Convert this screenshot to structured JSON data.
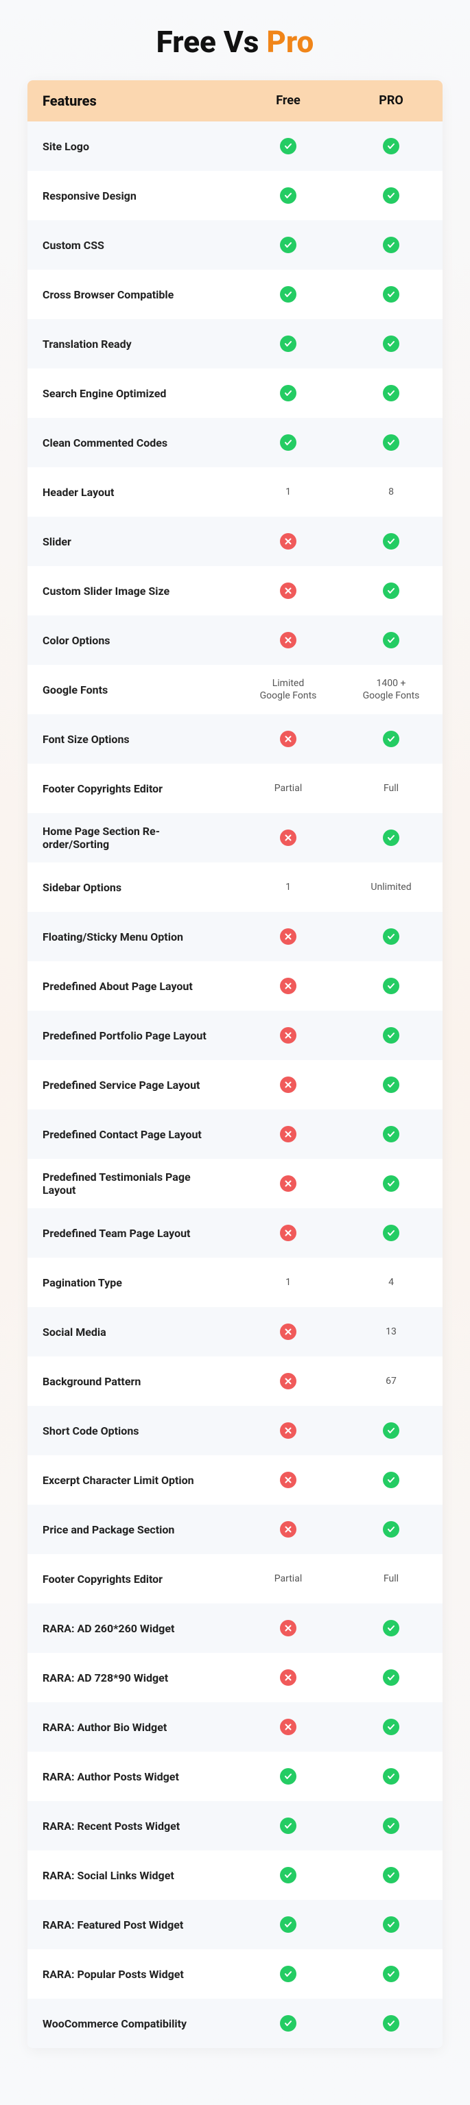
{
  "title": {
    "part1": "Free Vs ",
    "part2": "Pro"
  },
  "header": {
    "features": "Features",
    "free": "Free",
    "pro": "PRO"
  },
  "rows": [
    {
      "feature": "Site Logo",
      "free": {
        "type": "yes"
      },
      "pro": {
        "type": "yes"
      }
    },
    {
      "feature": "Responsive Design",
      "free": {
        "type": "yes"
      },
      "pro": {
        "type": "yes"
      }
    },
    {
      "feature": "Custom CSS",
      "free": {
        "type": "yes"
      },
      "pro": {
        "type": "yes"
      }
    },
    {
      "feature": "Cross Browser Compatible",
      "free": {
        "type": "yes"
      },
      "pro": {
        "type": "yes"
      }
    },
    {
      "feature": "Translation Ready",
      "free": {
        "type": "yes"
      },
      "pro": {
        "type": "yes"
      }
    },
    {
      "feature": "Search Engine Optimized",
      "free": {
        "type": "yes"
      },
      "pro": {
        "type": "yes"
      }
    },
    {
      "feature": "Clean Commented Codes",
      "free": {
        "type": "yes"
      },
      "pro": {
        "type": "yes"
      }
    },
    {
      "feature": "Header Layout",
      "free": {
        "type": "text",
        "value": "1"
      },
      "pro": {
        "type": "text",
        "value": "8"
      }
    },
    {
      "feature": "Slider",
      "free": {
        "type": "no"
      },
      "pro": {
        "type": "yes"
      }
    },
    {
      "feature": "Custom Slider Image Size",
      "free": {
        "type": "no"
      },
      "pro": {
        "type": "yes"
      }
    },
    {
      "feature": "Color Options",
      "free": {
        "type": "no"
      },
      "pro": {
        "type": "yes"
      }
    },
    {
      "feature": "Google Fonts",
      "free": {
        "type": "text",
        "value": "Limited\nGoogle Fonts"
      },
      "pro": {
        "type": "text",
        "value": "1400 +\nGoogle Fonts"
      }
    },
    {
      "feature": "Font Size Options",
      "free": {
        "type": "no"
      },
      "pro": {
        "type": "yes"
      }
    },
    {
      "feature": "Footer Copyrights Editor",
      "free": {
        "type": "text",
        "value": "Partial"
      },
      "pro": {
        "type": "text",
        "value": "Full"
      }
    },
    {
      "feature": "Home Page Section Re-order/Sorting",
      "free": {
        "type": "no"
      },
      "pro": {
        "type": "yes"
      }
    },
    {
      "feature": "Sidebar Options",
      "free": {
        "type": "text",
        "value": "1"
      },
      "pro": {
        "type": "text",
        "value": "Unlimited"
      }
    },
    {
      "feature": "Floating/Sticky Menu Option",
      "free": {
        "type": "no"
      },
      "pro": {
        "type": "yes"
      }
    },
    {
      "feature": "Predefined About Page Layout",
      "free": {
        "type": "no"
      },
      "pro": {
        "type": "yes"
      }
    },
    {
      "feature": "Predefined Portfolio Page Layout",
      "free": {
        "type": "no"
      },
      "pro": {
        "type": "yes"
      }
    },
    {
      "feature": "Predefined Service Page Layout",
      "free": {
        "type": "no"
      },
      "pro": {
        "type": "yes"
      }
    },
    {
      "feature": "Predefined Contact Page Layout",
      "free": {
        "type": "no"
      },
      "pro": {
        "type": "yes"
      }
    },
    {
      "feature": "Predefined Testimonials Page Layout",
      "free": {
        "type": "no"
      },
      "pro": {
        "type": "yes"
      }
    },
    {
      "feature": "Predefined Team Page Layout",
      "free": {
        "type": "no"
      },
      "pro": {
        "type": "yes"
      }
    },
    {
      "feature": "Pagination Type",
      "free": {
        "type": "text",
        "value": "1"
      },
      "pro": {
        "type": "text",
        "value": "4"
      }
    },
    {
      "feature": "Social Media",
      "free": {
        "type": "no"
      },
      "pro": {
        "type": "text",
        "value": "13"
      }
    },
    {
      "feature": "Background Pattern",
      "free": {
        "type": "no"
      },
      "pro": {
        "type": "text",
        "value": "67"
      }
    },
    {
      "feature": "Short Code Options",
      "free": {
        "type": "no"
      },
      "pro": {
        "type": "yes"
      }
    },
    {
      "feature": "Excerpt Character Limit Option",
      "free": {
        "type": "no"
      },
      "pro": {
        "type": "yes"
      }
    },
    {
      "feature": "Price and Package Section",
      "free": {
        "type": "no"
      },
      "pro": {
        "type": "yes"
      }
    },
    {
      "feature": "Footer Copyrights Editor",
      "free": {
        "type": "text",
        "value": "Partial"
      },
      "pro": {
        "type": "text",
        "value": "Full"
      }
    },
    {
      "feature": "RARA: AD 260*260 Widget",
      "free": {
        "type": "no"
      },
      "pro": {
        "type": "yes"
      }
    },
    {
      "feature": "RARA: AD 728*90 Widget",
      "free": {
        "type": "no"
      },
      "pro": {
        "type": "yes"
      }
    },
    {
      "feature": "RARA: Author Bio Widget",
      "free": {
        "type": "no"
      },
      "pro": {
        "type": "yes"
      }
    },
    {
      "feature": "RARA: Author Posts Widget",
      "free": {
        "type": "yes"
      },
      "pro": {
        "type": "yes"
      }
    },
    {
      "feature": "RARA: Recent Posts Widget",
      "free": {
        "type": "yes"
      },
      "pro": {
        "type": "yes"
      }
    },
    {
      "feature": "RARA: Social Links Widget",
      "free": {
        "type": "yes"
      },
      "pro": {
        "type": "yes"
      }
    },
    {
      "feature": "RARA: Featured Post Widget",
      "free": {
        "type": "yes"
      },
      "pro": {
        "type": "yes"
      }
    },
    {
      "feature": "RARA: Popular Posts Widget",
      "free": {
        "type": "yes"
      },
      "pro": {
        "type": "yes"
      }
    },
    {
      "feature": "WooCommerce Compatibility",
      "free": {
        "type": "yes"
      },
      "pro": {
        "type": "yes"
      }
    }
  ]
}
